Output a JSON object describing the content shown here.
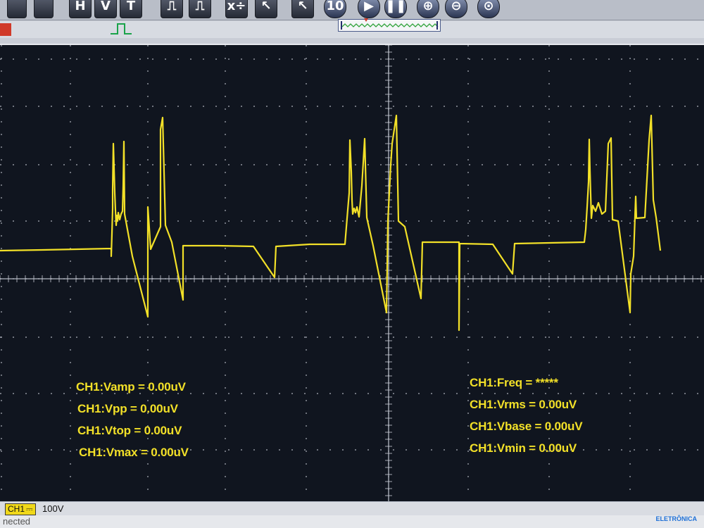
{
  "toolbar": {
    "buttons": [
      {
        "name": "print",
        "glyph": ""
      },
      {
        "name": "save",
        "glyph": ""
      },
      {
        "name": "h-cursor",
        "glyph": "H"
      },
      {
        "name": "v-cursor",
        "glyph": "V"
      },
      {
        "name": "t-cursor",
        "glyph": "T"
      },
      {
        "name": "pulse-edge",
        "glyph": "⎍"
      },
      {
        "name": "pulse-width",
        "glyph": "⎍"
      },
      {
        "name": "math",
        "glyph": "x÷"
      },
      {
        "name": "pointer",
        "glyph": "↖"
      },
      {
        "name": "cursor-select",
        "glyph": "↖"
      },
      {
        "name": "single",
        "glyph": "10"
      },
      {
        "name": "run",
        "glyph": "▶"
      },
      {
        "name": "stop",
        "glyph": "❚❚"
      },
      {
        "name": "zoom-in",
        "glyph": "⊕"
      },
      {
        "name": "zoom-out",
        "glyph": "⊖"
      },
      {
        "name": "zoom-fit",
        "glyph": "⊙"
      }
    ]
  },
  "measurements": {
    "vamp": "CH1:Vamp = 0.00uV",
    "vpp": "CH1:Vpp = 0.00uV",
    "vtop": "CH1:Vtop = 0.00uV",
    "vmax": "CH1:Vmax = 0.00uV",
    "freq": "CH1:Freq = *****",
    "vrms": "CH1:Vrms = 0.00uV",
    "vbase": "CH1:Vbase = 0.00uV",
    "vmin": "CH1:Vmin = 0.00uV"
  },
  "channel": {
    "tag": "CH1",
    "coupling": "⎓",
    "scale": "100V"
  },
  "status": {
    "connection": "nected"
  },
  "logo": {
    "text": "ELETRÔNICA"
  },
  "colors": {
    "trace": "#f2e028",
    "screen": "#10151f",
    "grid": "#c8ccd6"
  }
}
